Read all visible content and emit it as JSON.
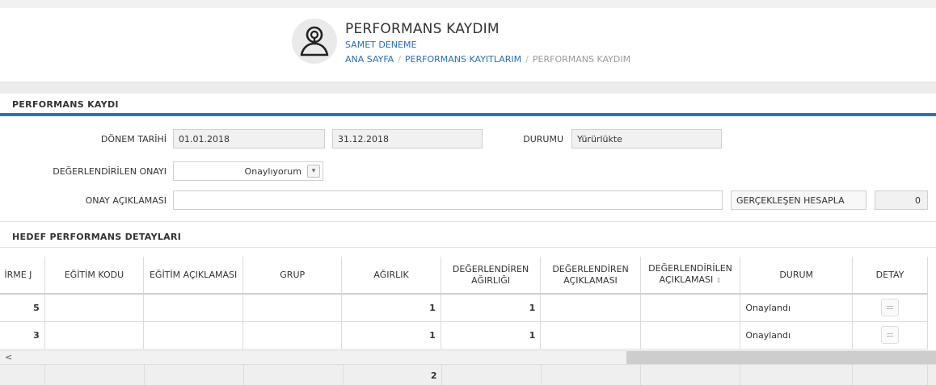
{
  "header": {
    "title": "PERFORMANS KAYDIM",
    "user": "SAMET DENEME",
    "breadcrumb": [
      "ANA SAYFA",
      "PERFORMANS KAYITLARIM",
      "PERFORMANS KAYDIM"
    ],
    "avatar_icon": "user-icon"
  },
  "form": {
    "section_title": "PERFORMANS KAYDI",
    "donem_label": "DÖNEM TARİHİ",
    "donem_start": "01.01.2018",
    "donem_end": "31.12.2018",
    "durum_label": "DURUMU",
    "durum_value": "Yürürlükte",
    "onay_label": "DEĞERLENDİRİLEN ONAYI",
    "onay_value": "Onaylıyorum",
    "aciklama_label": "ONAY AÇIKLAMASI",
    "aciklama_value": "",
    "hesapla_button": "GERÇEKLEŞEN HESAPLA",
    "hesapla_value": "0"
  },
  "details": {
    "section_title": "HEDEF PERFORMANS DETAYLARI",
    "columns": [
      "İRME J",
      "EĞİTİM KODU",
      "EĞİTİM AÇIKLAMASI",
      "GRUP",
      "AĞIRLIK",
      "DEĞERLENDİREN AĞIRLIĞI",
      "DEĞERLENDİREN AÇIKLAMASI",
      "DEĞERLENDİRİLEN AÇIKLAMASI",
      "DURUM",
      "DETAY"
    ],
    "rows": [
      {
        "c0": "5",
        "c1": "",
        "c2": "",
        "c3": "",
        "c4": "1",
        "c5": "1",
        "c6": "",
        "c7": "",
        "c8": "Onaylandı"
      },
      {
        "c0": "3",
        "c1": "",
        "c2": "",
        "c3": "",
        "c4": "1",
        "c5": "1",
        "c6": "",
        "c7": "",
        "c8": "Onaylandı"
      }
    ],
    "footer_total": "2",
    "scroll_left_icon": "<"
  }
}
